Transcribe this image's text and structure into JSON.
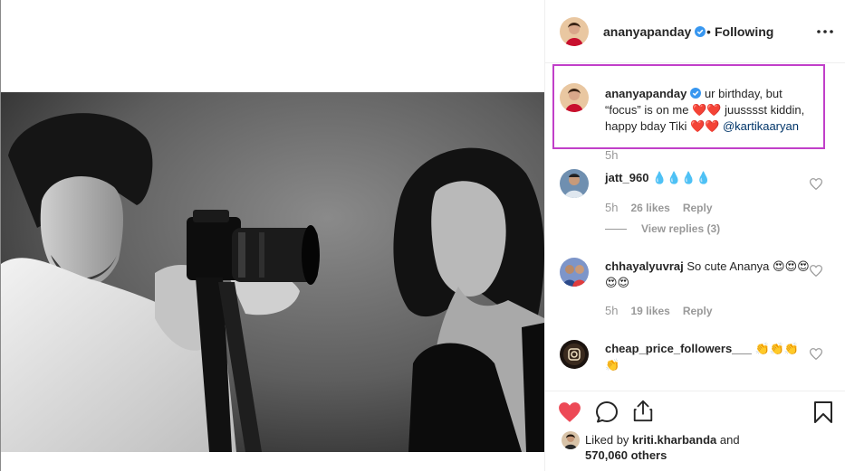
{
  "header": {
    "username": "ananyapanday",
    "separator": "•",
    "follow_status": "Following"
  },
  "caption": {
    "username": "ananyapanday",
    "text": "ur birthday, but “focus” is on me ❤️❤️ juusssst kiddin, happy bday Tiki ❤️❤️",
    "mention": "@kartikaaryan",
    "time": "5h"
  },
  "comments": [
    {
      "username": "jatt_960",
      "text": "💧💧💧💧",
      "time": "5h",
      "likes": "26 likes",
      "reply_label": "Reply",
      "view_replies": "View replies (3)"
    },
    {
      "username": "chhayalyuvraj",
      "text": "So cute Ananya 😍😍😍😍😍",
      "time": "5h",
      "likes": "19 likes",
      "reply_label": "Reply"
    },
    {
      "username": "cheap_price_followers___",
      "text": "👏👏👏👏"
    }
  ],
  "likes": {
    "prefix": "Liked by",
    "user": "kriti.kharbanda",
    "conjunction": "and",
    "count": "570,060 others"
  },
  "colors": {
    "highlight_border": "#c13fc9",
    "heart_red": "#ed4956",
    "verified_blue": "#3897f0",
    "mention_blue": "#003569"
  },
  "icons": [
    "more-options-icon",
    "verified-badge-icon",
    "heart-icon",
    "comment-icon",
    "share-icon",
    "bookmark-icon",
    "comment-like-heart-icon"
  ]
}
